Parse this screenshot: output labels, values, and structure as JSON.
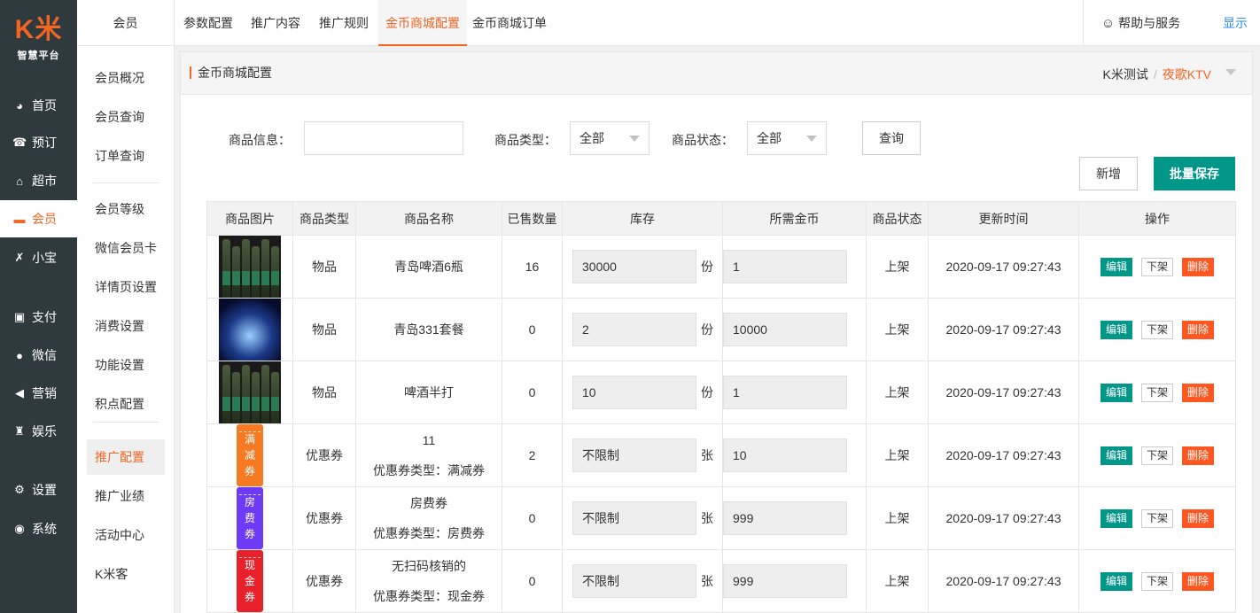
{
  "logo": {
    "mark": "K米",
    "subtitle": "智慧平台"
  },
  "leftnav": [
    {
      "label": "首页",
      "icon": "dashboard-icon",
      "glyph": "◕"
    },
    {
      "label": "预订",
      "icon": "booking-icon",
      "glyph": "☎"
    },
    {
      "label": "超市",
      "icon": "basket-icon",
      "glyph": "⌂"
    },
    {
      "label": "会员",
      "icon": "card-icon",
      "glyph": "▬"
    },
    {
      "label": "小宝",
      "icon": "xiaobao-icon",
      "glyph": "✗"
    },
    {
      "label": "支付",
      "icon": "payment-icon",
      "glyph": "▣"
    },
    {
      "label": "微信",
      "icon": "wechat-icon",
      "glyph": "●"
    },
    {
      "label": "营销",
      "icon": "megaphone-icon",
      "glyph": "◀"
    },
    {
      "label": "娱乐",
      "icon": "entertainment-icon",
      "glyph": "♜"
    },
    {
      "label": "设置",
      "icon": "gear-icon",
      "glyph": "⚙"
    },
    {
      "label": "系统",
      "icon": "system-icon",
      "glyph": "◉"
    }
  ],
  "submenu": {
    "title": "会员",
    "items": [
      "会员概况",
      "会员查询",
      "订单查询",
      "会员等级",
      "微信会员卡",
      "详情页设置",
      "消费设置",
      "功能设置",
      "积点配置",
      "推广配置",
      "推广业绩",
      "活动中心",
      "K米客"
    ]
  },
  "tabs": [
    "参数配置",
    "推广内容",
    "推广规则",
    "金币商城配置",
    "金币商城订单"
  ],
  "help": {
    "label": "帮助与服务",
    "icon": "☺"
  },
  "show_label": "显示",
  "panel": {
    "title": "金币商城配置",
    "breadcrumb": {
      "parent": "K米测试",
      "sep": "/",
      "current": "夜歌KTV"
    }
  },
  "filters": {
    "info_label": "商品信息：",
    "info_value": "",
    "type_label": "商品类型：",
    "type_value": "全部",
    "status_label": "商品状态：",
    "status_value": "全部",
    "query_button": "查询",
    "add_button": "新增",
    "batch_save_button": "批量保存"
  },
  "table": {
    "headers": [
      "商品图片",
      "商品类型",
      "商品名称",
      "已售数量",
      "库存",
      "所需金币",
      "商品状态",
      "更新时间",
      "操作"
    ],
    "actions": {
      "edit": "编辑",
      "down": "下架",
      "delete": "删除"
    },
    "rows": [
      {
        "image": "beer",
        "type": "物品",
        "name": "青岛啤酒6瓶",
        "name_sub": "",
        "sold": "16",
        "stock": "30000",
        "unit": "份",
        "coins": "1",
        "status": "上架",
        "updated": "2020-09-17 09:27:43"
      },
      {
        "image": "box",
        "type": "物品",
        "name": "青岛331套餐",
        "name_sub": "",
        "sold": "0",
        "stock": "2",
        "unit": "份",
        "coins": "10000",
        "status": "上架",
        "updated": "2020-09-17 09:27:43"
      },
      {
        "image": "beer",
        "type": "物品",
        "name": "啤酒半打",
        "name_sub": "",
        "sold": "0",
        "stock": "10",
        "unit": "份",
        "coins": "1",
        "status": "上架",
        "updated": "2020-09-17 09:27:43"
      },
      {
        "image": "coupon",
        "coupon_text": "满减券",
        "type": "优惠券",
        "name": "11",
        "name_sub": "优惠券类型：满减券",
        "sold": "2",
        "stock": "不限制",
        "unit": "张",
        "coins": "10",
        "status": "上架",
        "updated": "2020-09-17 09:27:43"
      },
      {
        "image": "coupon",
        "coupon_text": "房费券",
        "type": "优惠券",
        "name": "房费券",
        "name_sub": "优惠券类型：房费券",
        "sold": "0",
        "stock": "不限制",
        "unit": "张",
        "coins": "999",
        "status": "上架",
        "updated": "2020-09-17 09:27:43"
      },
      {
        "image": "coupon",
        "coupon_text": "现金券",
        "type": "优惠券",
        "name": "无扫码核销的",
        "name_sub": "优惠券类型：现金券",
        "sold": "0",
        "stock": "不限制",
        "unit": "张",
        "coins": "999",
        "status": "上架",
        "updated": "2020-09-17 09:27:43"
      }
    ]
  },
  "colors": {
    "accent": "#f26522",
    "nav_bg": "#2f3a3f",
    "green": "#009688",
    "danger": "#ff5722",
    "link": "#2d8cf0"
  }
}
